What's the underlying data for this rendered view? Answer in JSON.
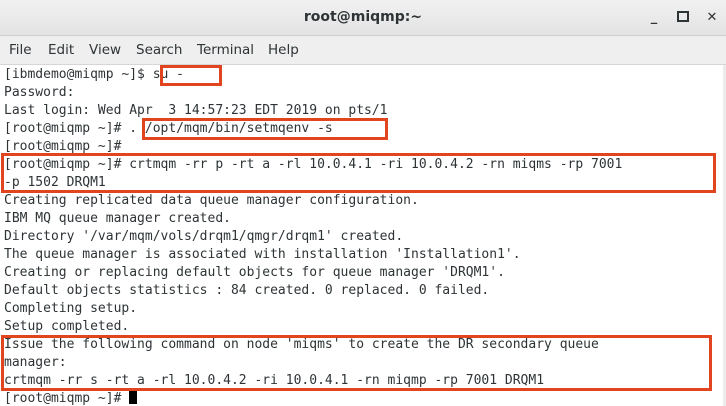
{
  "window": {
    "title": "root@miqmp:~",
    "minimize_glyph": "_",
    "close_glyph": "✕"
  },
  "menu": [
    "File",
    "Edit",
    "View",
    "Search",
    "Terminal",
    "Help"
  ],
  "terminal": {
    "lines": [
      "[ibmdemo@miqmp ~]$ su -",
      "Password:",
      "Last login: Wed Apr  3 14:57:23 EDT 2019 on pts/1",
      "[root@miqmp ~]# . /opt/mqm/bin/setmqenv -s",
      "[root@miqmp ~]#",
      "[root@miqmp ~]# crtmqm -rr p -rt a -rl 10.0.4.1 -ri 10.0.4.2 -rn miqms -rp 7001",
      "-p 1502 DRQM1",
      "Creating replicated data queue manager configuration.",
      "IBM MQ queue manager created.",
      "Directory '/var/mqm/vols/drqm1/qmgr/drqm1' created.",
      "The queue manager is associated with installation 'Installation1'.",
      "Creating or replacing default objects for queue manager 'DRQM1'.",
      "Default objects statistics : 84 created. 0 replaced. 0 failed.",
      "Completing setup.",
      "Setup completed.",
      "Issue the following command on node 'miqms' to create the DR secondary queue",
      "manager:",
      "crtmqm -rr s -rt a -rl 10.0.4.2 -ri 10.0.4.1 -rn miqmp -rp 7001 DRQM1",
      "[root@miqmp ~]# "
    ]
  },
  "colors": {
    "highlight": "#e0451f",
    "text": "#2e3436",
    "background": "#ffffff"
  }
}
